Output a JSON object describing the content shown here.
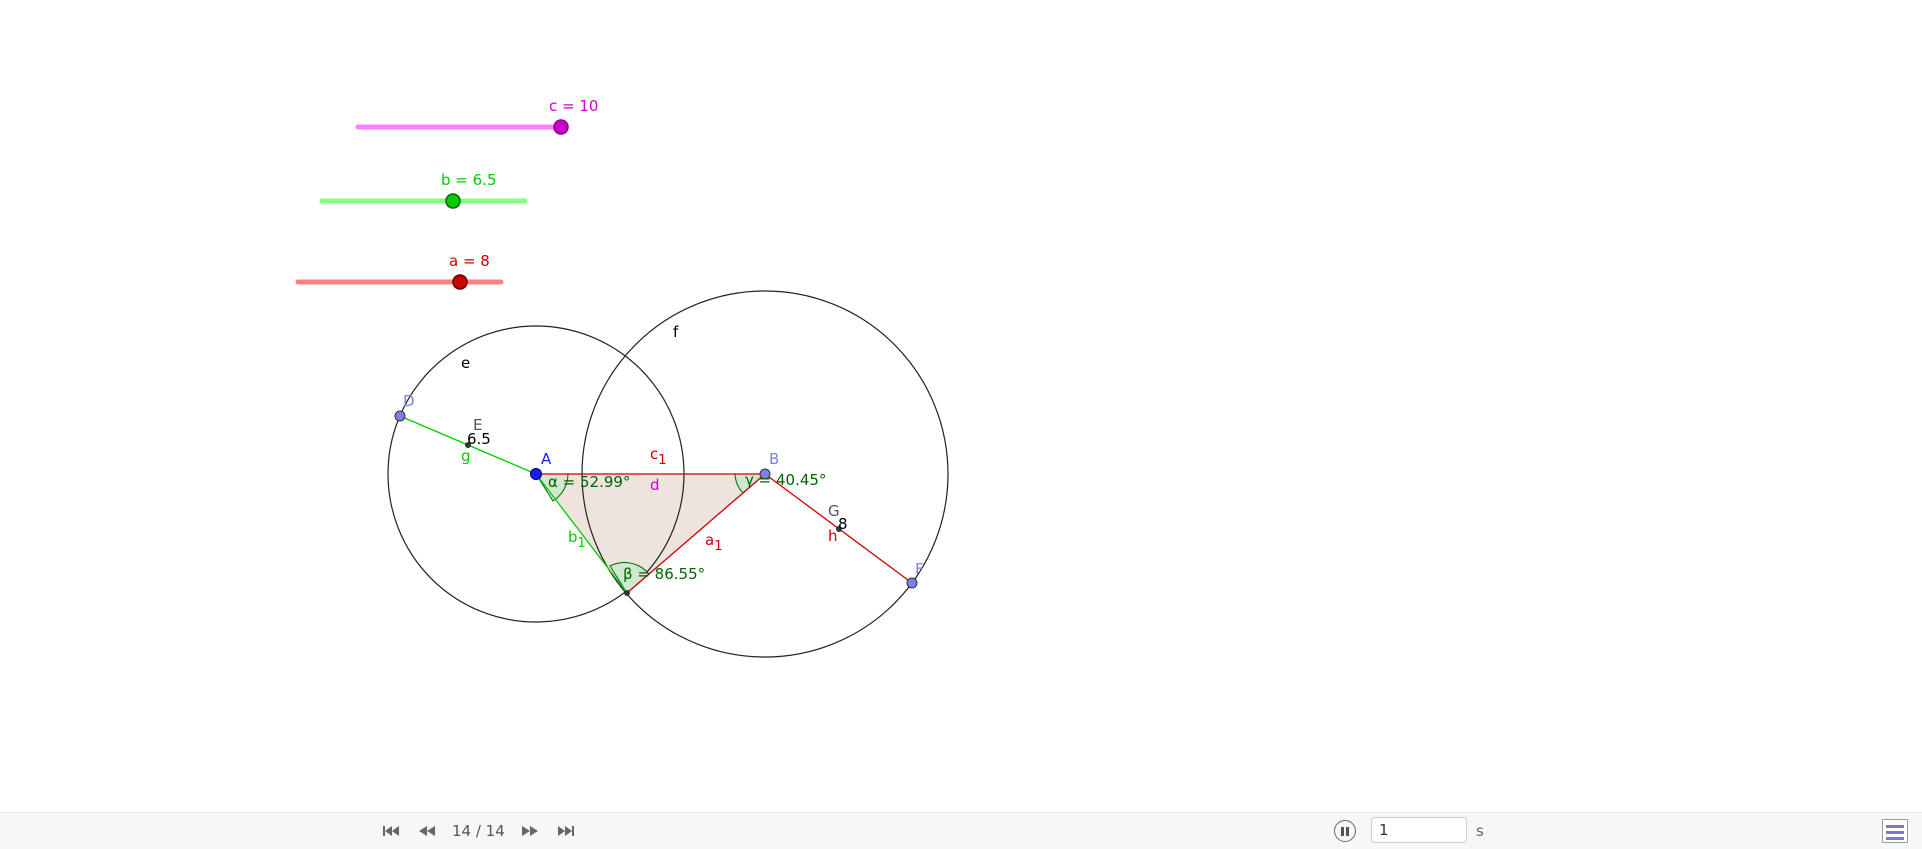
{
  "sliders": {
    "c": {
      "label": "c = 10",
      "color": "#cc00cc",
      "track_color": "#ff80ff",
      "value": 10
    },
    "b": {
      "label": "b = 6.5",
      "color": "#00cc00",
      "track_color": "#80ff80",
      "value": 6.5
    },
    "a": {
      "label": "a = 8",
      "color": "#cc0000",
      "track_color": "#ff8080",
      "value": 8
    }
  },
  "circle_labels": {
    "e": "e",
    "f": "f"
  },
  "points": {
    "A": "A",
    "B": "B",
    "D": "D",
    "E": "E",
    "F": "F",
    "G": "G"
  },
  "segment_labels": {
    "g": "g",
    "h": "h",
    "d": "d",
    "c1": "c",
    "c1_sub": "1",
    "b1": "b",
    "b1_sub": "1",
    "a1": "a",
    "a1_sub": "1"
  },
  "value_labels": {
    "E_value": "6.5",
    "G_value": "8"
  },
  "angles": {
    "alpha": "α = 52.99°",
    "beta": "β = 86.55°",
    "gamma": "γ = 40.45°"
  },
  "navigation": {
    "step_text": "14 / 14",
    "speed_value": "1",
    "speed_unit": "s"
  },
  "icons": {
    "first": "skip-to-first-icon",
    "prev": "rewind-icon",
    "next": "fast-forward-icon",
    "last": "skip-to-last-icon",
    "pause": "pause-icon",
    "algebra": "algebra-view-icon"
  },
  "colors": {
    "triangle_fill": "#efe3dd",
    "angle_fill": "#cfe8cf",
    "angle_text": "#006400",
    "free_point": "#7a80e8",
    "point_A": "#1a1aff",
    "circle_stroke": "#222222"
  }
}
